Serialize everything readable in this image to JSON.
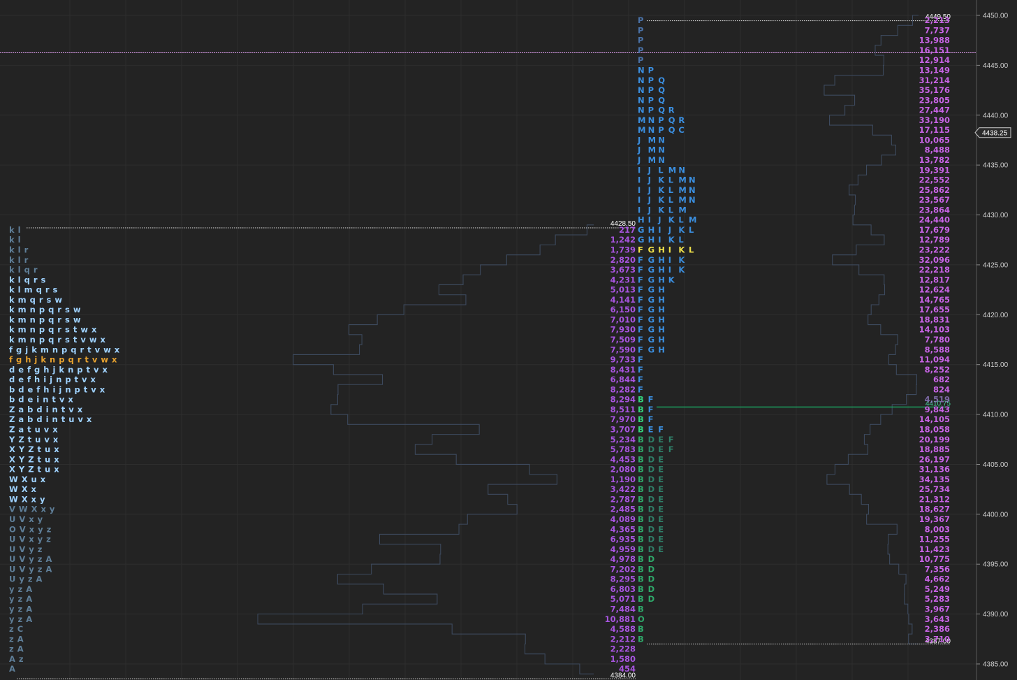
{
  "chart_data": {
    "type": "tpo_market_profile",
    "y_axis": {
      "min": 4382.25,
      "max": 4451.5,
      "ticks": [
        "4385.00",
        "4390.00",
        "4395.00",
        "4400.00",
        "4405.00",
        "4410.00",
        "4415.00",
        "4420.00",
        "4425.00",
        "4430.00",
        "4435.00",
        "4440.00",
        "4445.00",
        "4450.00"
      ],
      "last_price": "4438.25",
      "grid": true
    },
    "colors": {
      "background": "#232323",
      "grid": "#2e2e2e",
      "outline": "#3d4a5e",
      "volume": "#a855e0",
      "volume_right": "#c864e6",
      "letter_blue": "#3b8fe0",
      "letter_dim_blue": "#4a72a8",
      "letter_green": "#2ea86a",
      "letter_bright_green": "#34d17c",
      "letter_poc": "#f0e24a",
      "letter_left_bright": "#9fd2ff",
      "letter_left_dim": "#5f7f99",
      "letter_left_poc": "#e6a12f",
      "poc_line": "#19b86a",
      "tag_text": "#ffffff"
    },
    "left_profile": {
      "high_label": "4428.50",
      "low_label": "4384.00",
      "rows": [
        {
          "p": 4428.5,
          "s": "k l",
          "c": "dim"
        },
        {
          "p": 4427.5,
          "s": "k l",
          "c": "dim"
        },
        {
          "p": 4426.5,
          "s": "k l r",
          "c": "dim"
        },
        {
          "p": 4425.5,
          "s": "k l r",
          "c": "dim"
        },
        {
          "p": 4424.5,
          "s": "k l q r",
          "c": "dim"
        },
        {
          "p": 4423.5,
          "s": "k l q r s",
          "c": "bright"
        },
        {
          "p": 4422.5,
          "s": "k l m q r s",
          "c": "bright"
        },
        {
          "p": 4421.5,
          "s": "k m q r s w",
          "c": "bright"
        },
        {
          "p": 4420.5,
          "s": "k m n p q r s w",
          "c": "bright"
        },
        {
          "p": 4419.5,
          "s": "k m n p q r s w",
          "c": "bright"
        },
        {
          "p": 4418.5,
          "s": "k m n p q r s t w x",
          "c": "bright"
        },
        {
          "p": 4417.5,
          "s": "k m n p q r s t v w x",
          "c": "bright"
        },
        {
          "p": 4416.5,
          "s": "f g j k m n p q r t v w x",
          "c": "bright"
        },
        {
          "p": 4415.5,
          "s": "f g h j k n p q r t v w x",
          "c": "poc"
        },
        {
          "p": 4414.5,
          "s": "d e f g h j k n p t v x",
          "c": "bright"
        },
        {
          "p": 4413.5,
          "s": "d e f h i j n p t v x",
          "c": "bright"
        },
        {
          "p": 4412.5,
          "s": "b d e f h i j n p t v x",
          "c": "bright"
        },
        {
          "p": 4411.5,
          "s": "b d e i n t v x",
          "c": "bright"
        },
        {
          "p": 4410.5,
          "s": "Z a b d i n t v x",
          "c": "bright"
        },
        {
          "p": 4409.5,
          "s": "Z a b d i n t u v x",
          "c": "bright"
        },
        {
          "p": 4408.5,
          "s": "Z a t u v x",
          "c": "bright"
        },
        {
          "p": 4407.5,
          "s": "Y Z t u v x",
          "c": "bright"
        },
        {
          "p": 4406.5,
          "s": "X Y Z t u x",
          "c": "bright"
        },
        {
          "p": 4405.5,
          "s": "X Y Z t u x",
          "c": "bright"
        },
        {
          "p": 4404.5,
          "s": "X Y Z t u x",
          "c": "bright"
        },
        {
          "p": 4403.5,
          "s": "W X u x",
          "c": "bright"
        },
        {
          "p": 4402.5,
          "s": "W X x",
          "c": "bright"
        },
        {
          "p": 4401.5,
          "s": "W X x y",
          "c": "bright"
        },
        {
          "p": 4400.5,
          "s": "V W X x y",
          "c": "dim"
        },
        {
          "p": 4399.5,
          "s": "U V x y",
          "c": "dim"
        },
        {
          "p": 4398.5,
          "s": "O V x y z",
          "c": "dim"
        },
        {
          "p": 4397.5,
          "s": "U V x y z",
          "c": "dim"
        },
        {
          "p": 4396.5,
          "s": "U V y z",
          "c": "dim"
        },
        {
          "p": 4395.5,
          "s": "U V y z A",
          "c": "dim"
        },
        {
          "p": 4394.5,
          "s": "U V y z A",
          "c": "dim"
        },
        {
          "p": 4393.5,
          "s": "U y z A",
          "c": "dim"
        },
        {
          "p": 4392.5,
          "s": "y z A",
          "c": "dim"
        },
        {
          "p": 4391.5,
          "s": "y z A",
          "c": "dim"
        },
        {
          "p": 4390.5,
          "s": "y z A",
          "c": "dim"
        },
        {
          "p": 4389.5,
          "s": "y z A",
          "c": "dim"
        },
        {
          "p": 4388.5,
          "s": "z C",
          "c": "dim"
        },
        {
          "p": 4387.5,
          "s": "z A",
          "c": "dim"
        },
        {
          "p": 4386.5,
          "s": "z A",
          "c": "dim"
        },
        {
          "p": 4385.5,
          "s": "A z",
          "c": "dim"
        },
        {
          "p": 4384.5,
          "s": "A",
          "c": "dim"
        }
      ]
    },
    "middle_volume": [
      {
        "p": 4428.5,
        "v": "217"
      },
      {
        "p": 4427.5,
        "v": "1,242"
      },
      {
        "p": 4426.5,
        "v": "1,739"
      },
      {
        "p": 4425.5,
        "v": "2,820"
      },
      {
        "p": 4424.5,
        "v": "3,673"
      },
      {
        "p": 4423.5,
        "v": "4,231"
      },
      {
        "p": 4422.5,
        "v": "5,013"
      },
      {
        "p": 4421.5,
        "v": "4,141"
      },
      {
        "p": 4420.5,
        "v": "6,150"
      },
      {
        "p": 4419.5,
        "v": "7,010"
      },
      {
        "p": 4418.5,
        "v": "7,930"
      },
      {
        "p": 4417.5,
        "v": "7,509"
      },
      {
        "p": 4416.5,
        "v": "7,590"
      },
      {
        "p": 4415.5,
        "v": "9,733"
      },
      {
        "p": 4414.5,
        "v": "8,431"
      },
      {
        "p": 4413.5,
        "v": "6,844"
      },
      {
        "p": 4412.5,
        "v": "8,282"
      },
      {
        "p": 4411.5,
        "v": "8,294"
      },
      {
        "p": 4410.5,
        "v": "8,511"
      },
      {
        "p": 4409.5,
        "v": "7,970"
      },
      {
        "p": 4408.5,
        "v": "3,707"
      },
      {
        "p": 4407.5,
        "v": "5,234"
      },
      {
        "p": 4406.5,
        "v": "5,783"
      },
      {
        "p": 4405.5,
        "v": "4,453"
      },
      {
        "p": 4404.5,
        "v": "2,080"
      },
      {
        "p": 4403.5,
        "v": "1,190"
      },
      {
        "p": 4402.5,
        "v": "3,422"
      },
      {
        "p": 4401.5,
        "v": "2,787"
      },
      {
        "p": 4400.5,
        "v": "2,485"
      },
      {
        "p": 4399.5,
        "v": "4,089"
      },
      {
        "p": 4398.5,
        "v": "4,365"
      },
      {
        "p": 4397.5,
        "v": "6,935"
      },
      {
        "p": 4396.5,
        "v": "4,959"
      },
      {
        "p": 4395.5,
        "v": "4,978"
      },
      {
        "p": 4394.5,
        "v": "7,202"
      },
      {
        "p": 4393.5,
        "v": "8,295"
      },
      {
        "p": 4392.5,
        "v": "6,803"
      },
      {
        "p": 4391.5,
        "v": "5,071"
      },
      {
        "p": 4390.5,
        "v": "7,484"
      },
      {
        "p": 4389.5,
        "v": "10,881"
      },
      {
        "p": 4388.5,
        "v": "4,588"
      },
      {
        "p": 4387.5,
        "v": "2,212"
      },
      {
        "p": 4386.5,
        "v": "2,228"
      },
      {
        "p": 4385.5,
        "v": "1,580"
      },
      {
        "p": 4384.5,
        "v": "454"
      }
    ],
    "right_profile": {
      "high_label": "4449.50",
      "low_label": "4387.00",
      "poc_label": "4410.75",
      "rows": [
        {
          "p": 4449.5,
          "s": "P",
          "c": "dim"
        },
        {
          "p": 4448.5,
          "s": "P",
          "c": "dim"
        },
        {
          "p": 4447.5,
          "s": "P",
          "c": "dim"
        },
        {
          "p": 4446.5,
          "s": "P",
          "c": "dim"
        },
        {
          "p": 4445.5,
          "s": "P",
          "c": "dim"
        },
        {
          "p": 4444.5,
          "s": "N P",
          "c": "blue"
        },
        {
          "p": 4443.5,
          "s": "N P Q",
          "c": "blue"
        },
        {
          "p": 4442.5,
          "s": "N P Q",
          "c": "blue"
        },
        {
          "p": 4441.5,
          "s": "N P Q",
          "c": "blue"
        },
        {
          "p": 4440.5,
          "s": "N P Q R",
          "c": "blue"
        },
        {
          "p": 4439.5,
          "s": "M N P Q R",
          "c": "blue"
        },
        {
          "p": 4438.5,
          "s": "M N P Q C",
          "c": "blue"
        },
        {
          "p": 4437.5,
          "s": "J M N",
          "c": "blue"
        },
        {
          "p": 4436.5,
          "s": "J M N",
          "c": "blue"
        },
        {
          "p": 4435.5,
          "s": "J M N",
          "c": "blue"
        },
        {
          "p": 4434.5,
          "s": "I J L M N",
          "c": "blue"
        },
        {
          "p": 4433.5,
          "s": "I J K L M N",
          "c": "blue"
        },
        {
          "p": 4432.5,
          "s": "I J K L M N",
          "c": "blue"
        },
        {
          "p": 4431.5,
          "s": "I J K L M N",
          "c": "blue"
        },
        {
          "p": 4430.5,
          "s": "I J K L M",
          "c": "blue"
        },
        {
          "p": 4429.5,
          "s": "H I J K L M",
          "c": "blue"
        },
        {
          "p": 4428.5,
          "s": "G H I J K L",
          "c": "blue"
        },
        {
          "p": 4427.5,
          "s": "G H I K L",
          "c": "blue"
        },
        {
          "p": 4426.5,
          "s": "F G H I K L",
          "c": "poc"
        },
        {
          "p": 4425.5,
          "s": "F G H I K",
          "c": "blue"
        },
        {
          "p": 4424.5,
          "s": "F G H I K",
          "c": "blue"
        },
        {
          "p": 4423.5,
          "s": "F G H K",
          "c": "blue"
        },
        {
          "p": 4422.5,
          "s": "F G H",
          "c": "blue"
        },
        {
          "p": 4421.5,
          "s": "F G H",
          "c": "blue"
        },
        {
          "p": 4420.5,
          "s": "F G H",
          "c": "blue"
        },
        {
          "p": 4419.5,
          "s": "F G H",
          "c": "blue"
        },
        {
          "p": 4418.5,
          "s": "F G H",
          "c": "blue"
        },
        {
          "p": 4417.5,
          "s": "F G H",
          "c": "blue"
        },
        {
          "p": 4416.5,
          "s": "F G H",
          "c": "blue"
        },
        {
          "p": 4415.5,
          "s": "F",
          "c": "blue"
        },
        {
          "p": 4414.5,
          "s": "F",
          "c": "blue"
        },
        {
          "p": 4413.5,
          "s": "F",
          "c": "blue"
        },
        {
          "p": 4412.5,
          "s": "F",
          "c": "blue"
        },
        {
          "p": 4411.5,
          "s": "B F",
          "c": "bg"
        },
        {
          "p": 4410.5,
          "s": "B F",
          "c": "bg"
        },
        {
          "p": 4409.5,
          "s": "B F",
          "c": "bg"
        },
        {
          "p": 4408.5,
          "s": "B E F",
          "c": "bg"
        },
        {
          "p": 4407.5,
          "s": "B D E F",
          "c": "gdim"
        },
        {
          "p": 4406.5,
          "s": "B D E F",
          "c": "gdim"
        },
        {
          "p": 4405.5,
          "s": "B D E",
          "c": "gdim"
        },
        {
          "p": 4404.5,
          "s": "B D E",
          "c": "gdim"
        },
        {
          "p": 4403.5,
          "s": "B D E",
          "c": "gdim"
        },
        {
          "p": 4402.5,
          "s": "B D E",
          "c": "gdim"
        },
        {
          "p": 4401.5,
          "s": "B D E",
          "c": "gdim"
        },
        {
          "p": 4400.5,
          "s": "B D E",
          "c": "gdim"
        },
        {
          "p": 4399.5,
          "s": "B D E",
          "c": "gdim"
        },
        {
          "p": 4398.5,
          "s": "B D E",
          "c": "gdim"
        },
        {
          "p": 4397.5,
          "s": "B D E",
          "c": "gdim"
        },
        {
          "p": 4396.5,
          "s": "B D E",
          "c": "gdim"
        },
        {
          "p": 4395.5,
          "s": "B D",
          "c": "green"
        },
        {
          "p": 4394.5,
          "s": "B D",
          "c": "green"
        },
        {
          "p": 4393.5,
          "s": "B D",
          "c": "green"
        },
        {
          "p": 4392.5,
          "s": "B D",
          "c": "green"
        },
        {
          "p": 4391.5,
          "s": "B D",
          "c": "green"
        },
        {
          "p": 4390.5,
          "s": "B",
          "c": "green"
        },
        {
          "p": 4389.5,
          "s": "O",
          "c": "green"
        },
        {
          "p": 4388.5,
          "s": "B",
          "c": "green"
        },
        {
          "p": 4387.5,
          "s": "B",
          "c": "green"
        }
      ]
    },
    "right_volume": [
      {
        "p": 4449.5,
        "v": "2,213"
      },
      {
        "p": 4448.5,
        "v": "7,737"
      },
      {
        "p": 4447.5,
        "v": "13,988"
      },
      {
        "p": 4446.5,
        "v": "16,151"
      },
      {
        "p": 4445.5,
        "v": "12,914"
      },
      {
        "p": 4444.5,
        "v": "13,149"
      },
      {
        "p": 4443.5,
        "v": "31,214"
      },
      {
        "p": 4442.5,
        "v": "35,176"
      },
      {
        "p": 4441.5,
        "v": "23,805"
      },
      {
        "p": 4440.5,
        "v": "27,447"
      },
      {
        "p": 4439.5,
        "v": "33,190"
      },
      {
        "p": 4438.5,
        "v": "17,115"
      },
      {
        "p": 4437.5,
        "v": "10,065"
      },
      {
        "p": 4436.5,
        "v": "8,488"
      },
      {
        "p": 4435.5,
        "v": "13,782"
      },
      {
        "p": 4434.5,
        "v": "19,391"
      },
      {
        "p": 4433.5,
        "v": "22,552"
      },
      {
        "p": 4432.5,
        "v": "25,862"
      },
      {
        "p": 4431.5,
        "v": "23,567"
      },
      {
        "p": 4430.5,
        "v": "23,864"
      },
      {
        "p": 4429.5,
        "v": "24,440"
      },
      {
        "p": 4428.5,
        "v": "17,679"
      },
      {
        "p": 4427.5,
        "v": "12,789"
      },
      {
        "p": 4426.5,
        "v": "23,222"
      },
      {
        "p": 4425.5,
        "v": "32,096"
      },
      {
        "p": 4424.5,
        "v": "22,218"
      },
      {
        "p": 4423.5,
        "v": "12,817"
      },
      {
        "p": 4422.5,
        "v": "12,624"
      },
      {
        "p": 4421.5,
        "v": "14,765"
      },
      {
        "p": 4420.5,
        "v": "17,655"
      },
      {
        "p": 4419.5,
        "v": "18,831"
      },
      {
        "p": 4418.5,
        "v": "14,103"
      },
      {
        "p": 4417.5,
        "v": "7,780"
      },
      {
        "p": 4416.5,
        "v": "8,588"
      },
      {
        "p": 4415.5,
        "v": "11,094"
      },
      {
        "p": 4414.5,
        "v": "8,252"
      },
      {
        "p": 4413.5,
        "v": "682"
      },
      {
        "p": 4412.5,
        "v": "824"
      },
      {
        "p": 4411.5,
        "v": "4,519"
      },
      {
        "p": 4410.5,
        "v": "9,843"
      },
      {
        "p": 4409.5,
        "v": "14,105"
      },
      {
        "p": 4408.5,
        "v": "18,058"
      },
      {
        "p": 4407.5,
        "v": "20,199"
      },
      {
        "p": 4406.5,
        "v": "18,885"
      },
      {
        "p": 4405.5,
        "v": "26,197"
      },
      {
        "p": 4404.5,
        "v": "31,136"
      },
      {
        "p": 4403.5,
        "v": "34,135"
      },
      {
        "p": 4402.5,
        "v": "25,734"
      },
      {
        "p": 4401.5,
        "v": "21,312"
      },
      {
        "p": 4400.5,
        "v": "18,627"
      },
      {
        "p": 4399.5,
        "v": "19,367"
      },
      {
        "p": 4398.5,
        "v": "8,003"
      },
      {
        "p": 4397.5,
        "v": "11,255"
      },
      {
        "p": 4396.5,
        "v": "11,423"
      },
      {
        "p": 4395.5,
        "v": "10,775"
      },
      {
        "p": 4394.5,
        "v": "7,356"
      },
      {
        "p": 4393.5,
        "v": "4,662"
      },
      {
        "p": 4392.5,
        "v": "5,249"
      },
      {
        "p": 4391.5,
        "v": "5,283"
      },
      {
        "p": 4390.5,
        "v": "3,967"
      },
      {
        "p": 4389.5,
        "v": "3,643"
      },
      {
        "p": 4388.5,
        "v": "2,386"
      },
      {
        "p": 4387.5,
        "v": "3,710"
      }
    ],
    "reference_lines": [
      {
        "kind": "pink-dotted",
        "price": 4446.25,
        "color": "#d89ae8"
      }
    ]
  }
}
